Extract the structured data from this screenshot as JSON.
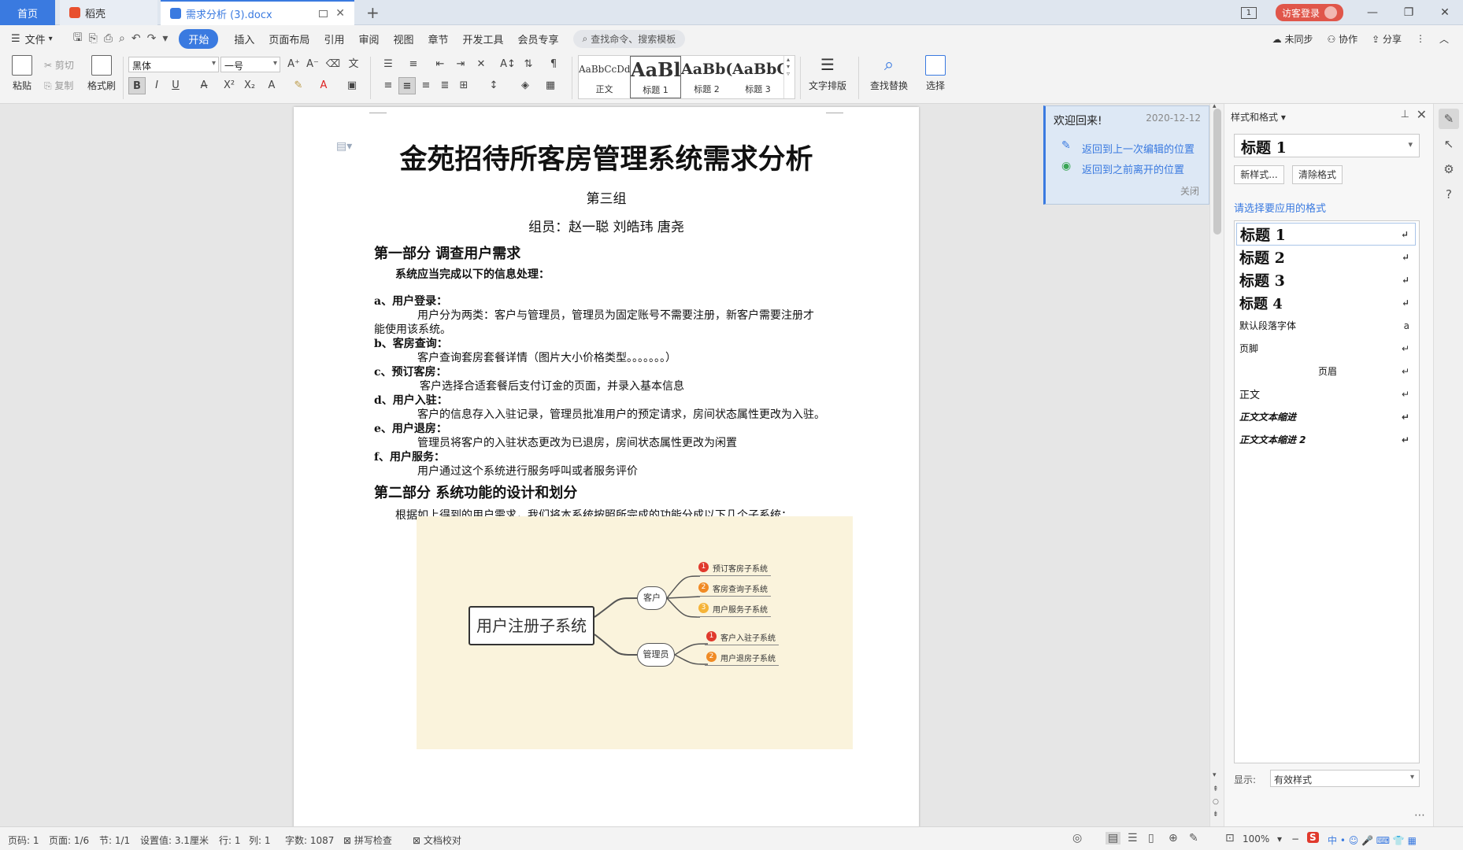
{
  "tabs": {
    "home": "首页",
    "daoke": "稻壳",
    "doc": "需求分析 (3).docx",
    "new_tab": "+",
    "badge": "1",
    "login": "访客登录"
  },
  "menu": {
    "file": "文件",
    "items": [
      "开始",
      "插入",
      "页面布局",
      "引用",
      "审阅",
      "视图",
      "章节",
      "开发工具",
      "会员专享"
    ],
    "search_placeholder": "查找命令、搜索模板",
    "right": [
      "未同步",
      "协作",
      "分享"
    ]
  },
  "ribbon": {
    "paste": "粘贴",
    "cut": "剪切",
    "copy": "复制",
    "format_painter": "格式刷",
    "font_name": "黑体",
    "font_size": "一号",
    "styles": [
      {
        "sample": "AaBbCcDd",
        "label": "正文"
      },
      {
        "sample": "AaBl",
        "label": "标题 1"
      },
      {
        "sample": "AaBb(",
        "label": "标题 2"
      },
      {
        "sample": "AaBbC",
        "label": "标题 3"
      }
    ],
    "text_layout": "文字排版",
    "find_replace": "查找替换",
    "select": "选择"
  },
  "document": {
    "title": "金苑招待所客房管理系统需求分析",
    "group": "第三组",
    "members": "组员：赵一聪 刘皓玮 唐尧",
    "part1": "第一部分 调查用户需求",
    "intro": "系统应当完成以下的信息处理：",
    "items": [
      {
        "label": "a、用户登录：",
        "text": "用户分为两类：客户与管理员，管理员为固定账号不需要注册，新客户需要注册才",
        "cont": "能使用该系统。"
      },
      {
        "label": "b、客房查询：",
        "text": "客户查询套房套餐详情（图片大小价格类型。。。。。。。）"
      },
      {
        "label": "c、预订客房：",
        "text": "客户选择合适套餐后支付订金的页面，并录入基本信息"
      },
      {
        "label": "d、用户入驻：",
        "text": "客户的信息存入入驻记录，管理员批准用户的预定请求，房间状态属性更改为入驻。"
      },
      {
        "label": "e、用户退房：",
        "text": "管理员将客户的入驻状态更改为已退房，房间状态属性更改为闲置"
      },
      {
        "label": "f、用户服务：",
        "text": "用户通过这个系统进行服务呼叫或者服务评价"
      }
    ],
    "part2": "第二部分 系统功能的设计和划分",
    "part2_intro": "根据如上得到的用户需求，我们将本系统按照所完成的功能分成以下几个子系统：",
    "mindmap": {
      "root": "用户注册子系统",
      "customer": "客户",
      "admin": "管理员",
      "customer_leaves": [
        "预订客房子系统",
        "客房查询子系统",
        "用户服务子系统"
      ],
      "admin_leaves": [
        "客户入驻子系统",
        "用户退房子系统"
      ],
      "colors": [
        "#e0392c",
        "#f08a24",
        "#f5b338"
      ]
    }
  },
  "welcome": {
    "title": "欢迎回来!",
    "date": "2020-12-12",
    "link1": "返回到上一次编辑的位置",
    "link2": "返回到之前离开的位置",
    "close": "关闭"
  },
  "panel": {
    "header": "样式和格式",
    "current_style": "标题 1",
    "new_style": "新样式...",
    "clear_format": "清除格式",
    "apply_label": "请选择要应用的格式",
    "styles": [
      {
        "name": "标题 1",
        "mark": "↵"
      },
      {
        "name": "标题 2",
        "mark": "↵"
      },
      {
        "name": "标题 3",
        "mark": "↵"
      },
      {
        "name": "标题 4",
        "mark": "↵"
      },
      {
        "name": "默认段落字体",
        "mark": "a"
      },
      {
        "name": "页脚",
        "mark": "↵"
      },
      {
        "name": "页眉",
        "mark": "↵"
      },
      {
        "name": "正文",
        "mark": "↵"
      },
      {
        "name": "正文文本缩进",
        "mark": "↵"
      },
      {
        "name": "正文文本缩进 2",
        "mark": "↵"
      }
    ],
    "show_label": "显示:",
    "show_value": "有效样式"
  },
  "status": {
    "page_num": "页码: 1",
    "page": "页面: 1/6",
    "section": "节: 1/1",
    "setting": "设置值: 3.1厘米",
    "row": "行: 1",
    "col": "列: 1",
    "words": "字数: 1087",
    "spell": "拼写检查",
    "proof": "文档校对",
    "zoom": "100%"
  },
  "colors": {
    "accent": "#3a7ae0",
    "login": "#e0564a",
    "mindmap_bg": "#faf3dc"
  }
}
